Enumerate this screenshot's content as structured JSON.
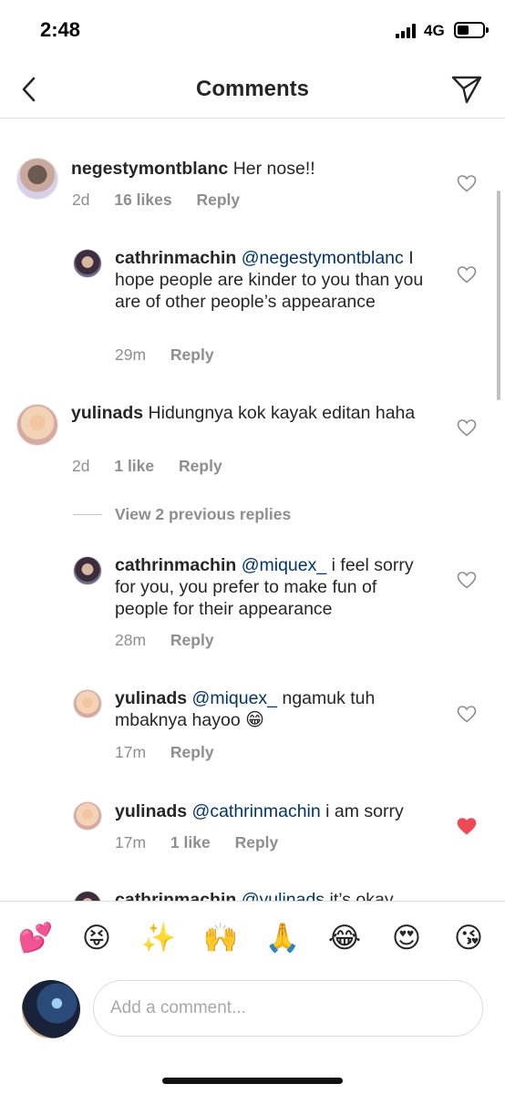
{
  "status_bar": {
    "time": "2:48",
    "network": "4G",
    "battery_level": 0.45
  },
  "header": {
    "title": "Comments",
    "back_icon": "chevron-left-icon",
    "share_icon": "paper-plane-icon"
  },
  "comments": [
    {
      "username": "negestymontblanc",
      "mention": "",
      "text": "Her nose!!",
      "time": "2d",
      "likes": "16 likes",
      "reply_label": "Reply",
      "liked": false
    },
    {
      "username": "cathrinmachin",
      "mention": "@negestymontblanc",
      "text": "I hope people are kinder to you than you are of other people’s appearance",
      "time": "29m",
      "likes": "",
      "reply_label": "Reply",
      "liked": false
    },
    {
      "username": "yulinads",
      "mention": "",
      "text": "Hidungnya kok kayak editan haha",
      "time": "2d",
      "likes": "1 like",
      "reply_label": "Reply",
      "liked": false
    },
    {
      "username": "cathrinmachin",
      "mention": "@miquex_",
      "text": "i feel sorry for you, you prefer to make fun of people for their appearance",
      "time": "28m",
      "likes": "",
      "reply_label": "Reply",
      "liked": false
    },
    {
      "username": "yulinads",
      "mention": "@miquex_",
      "text": "ngamuk tuh mbaknya hayoo",
      "emoji": "😁",
      "time": "17m",
      "likes": "",
      "reply_label": "Reply",
      "liked": false
    },
    {
      "username": "yulinads",
      "mention": "@cathrinmachin",
      "text": "i am sorry",
      "time": "17m",
      "likes": "1 like",
      "reply_label": "Reply",
      "liked": true
    },
    {
      "username": "cathrinmachin",
      "mention": "@yulinads",
      "text": "it’s okay",
      "time": "",
      "likes": "",
      "reply_label": "",
      "liked": false
    }
  ],
  "view_replies_label": "View 2 previous replies",
  "quick_emojis": [
    "💕",
    "😝",
    "✨",
    "🙌",
    "🙏",
    "😂",
    "😍",
    "😘"
  ],
  "comment_input": {
    "placeholder": "Add a comment..."
  },
  "colors": {
    "text": "#262626",
    "secondary": "#8e8e8e",
    "mention": "#003569",
    "liked_heart": "#ed4956",
    "divider": "#dbdbdb"
  }
}
